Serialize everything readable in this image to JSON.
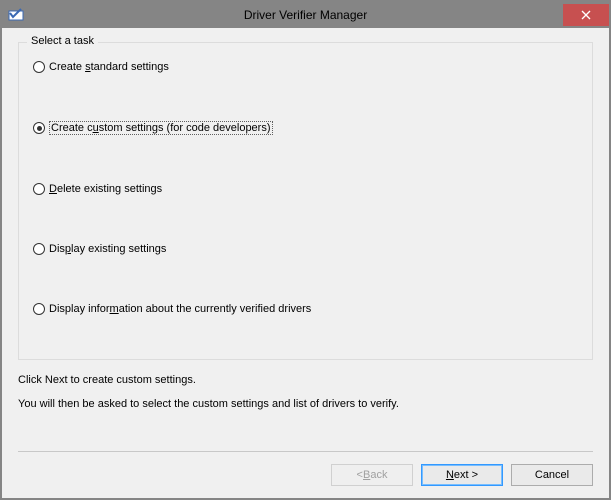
{
  "window": {
    "title": "Driver Verifier Manager"
  },
  "group": {
    "title": "Select a task"
  },
  "options": {
    "opt1_pre": "Create ",
    "opt1_u": "s",
    "opt1_post": "tandard settings",
    "opt2_pre": "Create c",
    "opt2_u": "u",
    "opt2_post": "stom settings (for code developers)",
    "opt3_pre": "",
    "opt3_u": "D",
    "opt3_post": "elete existing settings",
    "opt4_pre": "Dis",
    "opt4_u": "p",
    "opt4_post": "lay existing settings",
    "opt5_pre": "Display infor",
    "opt5_u": "m",
    "opt5_post": "ation about the currently verified drivers"
  },
  "instructions": {
    "line1": "Click Next to create custom settings.",
    "line2": "You will then be asked to select the custom settings and list of drivers to verify."
  },
  "buttons": {
    "back_pre": "< ",
    "back_u": "B",
    "back_post": "ack",
    "next_pre": "",
    "next_u": "N",
    "next_post": "ext >",
    "cancel": "Cancel"
  }
}
